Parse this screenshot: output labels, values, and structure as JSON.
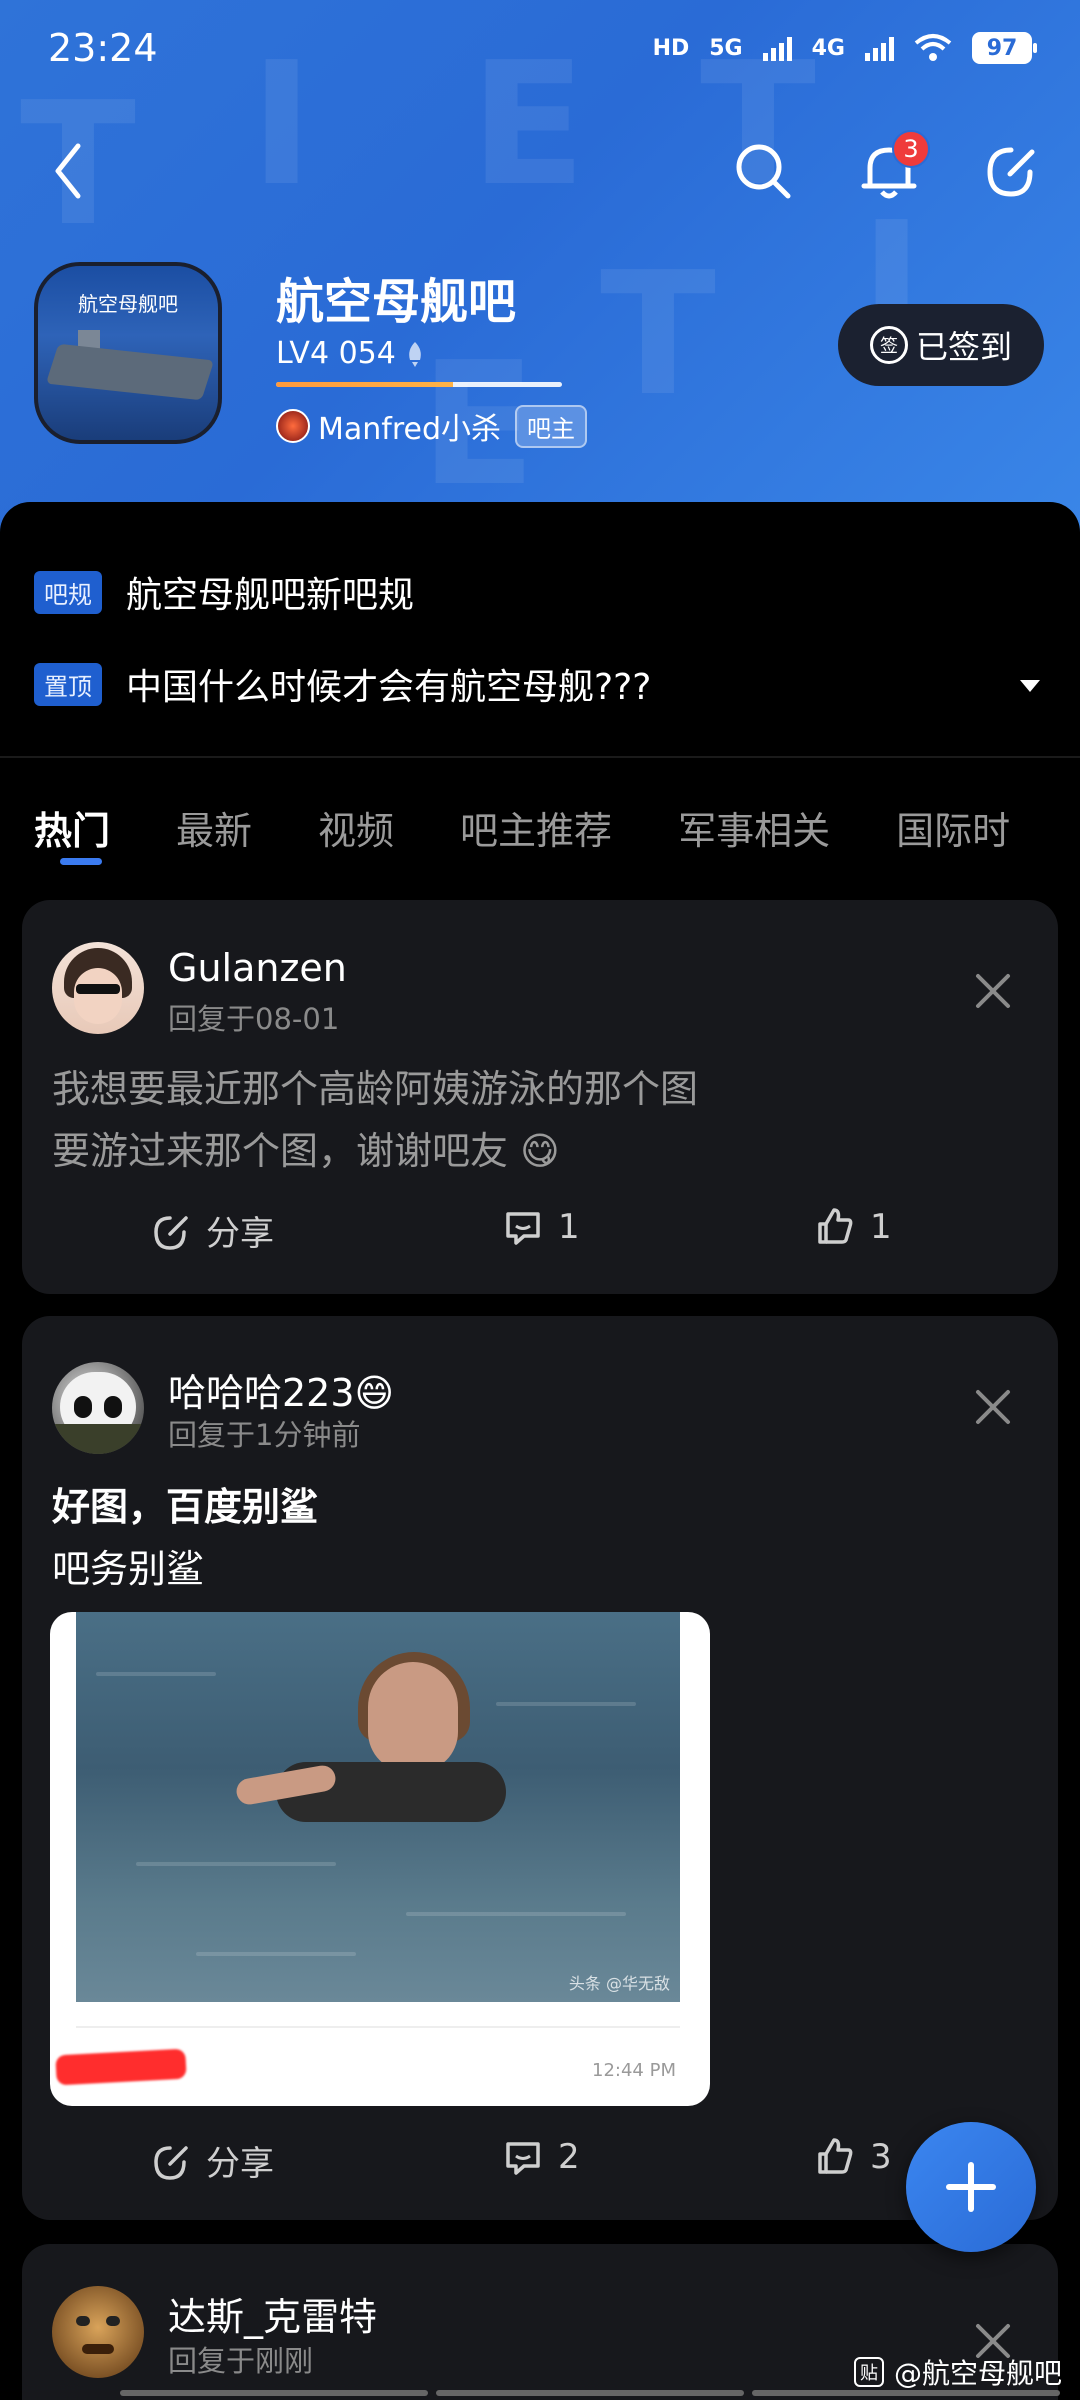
{
  "status_bar": {
    "time": "23:24",
    "hd_label": "HD",
    "net1": "5G",
    "net2": "4G",
    "battery": "97"
  },
  "header": {
    "notification_count": "3",
    "forum": {
      "avatar_text": "航空母舰吧",
      "name": "航空母舰吧",
      "level": "LV4 054",
      "level_progress": 0.62,
      "moderator_name": "Manfred小杀",
      "moderator_badge": "吧主",
      "signed_label": "已签到",
      "sign_icon_text": "签"
    }
  },
  "notices": [
    {
      "tag": "吧规",
      "text": "航空母舰吧新吧规"
    },
    {
      "tag": "置顶",
      "text": "中国什么时候才会有航空母舰???"
    }
  ],
  "tabs": [
    "热门",
    "最新",
    "视频",
    "吧主推荐",
    "军事相关",
    "国际时"
  ],
  "posts": [
    {
      "user": "Gulanzen",
      "meta": "回复于08-01",
      "lines": [
        "我想要最近那个高龄阿姨游泳的那个图",
        "要游过来那个图，谢谢吧友 😋"
      ],
      "share": "分享",
      "comments": "1",
      "likes": "1"
    },
    {
      "user": "哈哈哈223😄",
      "meta": "回复于1分钟前",
      "lines": [
        "好图，百度别鲨",
        "吧务别鲨"
      ],
      "image_watermark": "头条 @华无敌",
      "image_time": "12:44 PM",
      "share": "分享",
      "comments": "2",
      "likes": "3"
    },
    {
      "user": "达斯_克雷特",
      "meta": "回复于刚刚"
    }
  ],
  "bottom_watermark": {
    "icon": "贴",
    "text": "@航空母舰吧"
  },
  "colors": {
    "accent": "#2a6bd6",
    "card": "#17181c",
    "tag": "#1f5fcf",
    "badge": "#ef3b3b"
  }
}
